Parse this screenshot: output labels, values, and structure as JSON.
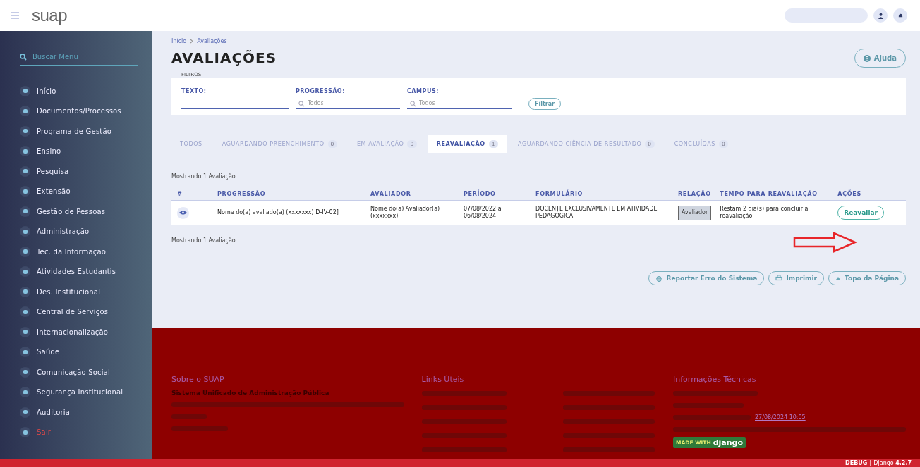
{
  "header": {
    "logo": "suap"
  },
  "sidebar": {
    "search": {
      "placeholder": "Buscar Menu"
    },
    "items": [
      {
        "label": "Início",
        "kind": "normal"
      },
      {
        "label": "Documentos/Processos",
        "kind": "normal"
      },
      {
        "label": "Programa de Gestão",
        "kind": "normal"
      },
      {
        "label": "Ensino",
        "kind": "normal"
      },
      {
        "label": "Pesquisa",
        "kind": "normal"
      },
      {
        "label": "Extensão",
        "kind": "normal"
      },
      {
        "label": "Gestão de Pessoas",
        "kind": "normal"
      },
      {
        "label": "Administração",
        "kind": "normal"
      },
      {
        "label": "Tec. da Informação",
        "kind": "normal"
      },
      {
        "label": "Atividades Estudantis",
        "kind": "normal"
      },
      {
        "label": "Des. Institucional",
        "kind": "normal"
      },
      {
        "label": "Central de Serviços",
        "kind": "normal"
      },
      {
        "label": "Internacionalização",
        "kind": "normal"
      },
      {
        "label": "Saúde",
        "kind": "normal"
      },
      {
        "label": "Comunicação Social",
        "kind": "normal"
      },
      {
        "label": "Segurança Institucional",
        "kind": "normal"
      },
      {
        "label": "Auditoria",
        "kind": "normal"
      },
      {
        "label": "Sair",
        "kind": "logout"
      }
    ]
  },
  "breadcrumb": [
    "Início",
    "Avaliações"
  ],
  "title": "AVALIAÇÕES",
  "help_button": "Ajuda",
  "filters": {
    "legend": "FILTROS",
    "fields": [
      {
        "label": "TEXTO:"
      },
      {
        "label": "PROGRESSÃO:",
        "placeholder": "Todos"
      },
      {
        "label": "CAMPUS:",
        "placeholder": "Todos"
      }
    ],
    "button": "Filtrar"
  },
  "tabs": [
    {
      "label": "TODOS",
      "selected": false
    },
    {
      "label": "AGUARDANDO PREENCHIMENTO",
      "count": "0",
      "selected": false
    },
    {
      "label": "EM AVALIAÇÃO",
      "count": "0",
      "selected": false
    },
    {
      "label": "REAVALIAÇÃO",
      "count": "1",
      "selected": true
    },
    {
      "label": "AGUARDANDO CIÊNCIA DE RESULTADO",
      "count": "0",
      "selected": false
    },
    {
      "label": "CONCLUÍDAS",
      "count": "0",
      "selected": false
    }
  ],
  "summary_top": "Mostrando 1 Avaliação",
  "table": {
    "columns": [
      "#",
      "PROGRESSÃO",
      "AVALIADOR",
      "PERÍODO",
      "FORMULÁRIO",
      "RELAÇÃO",
      "TEMPO PARA REAVALIAÇÃO",
      "AÇÕES"
    ],
    "rows": [
      {
        "progressao": "Nome do(a) avaliado(a) (xxxxxxx) D-IV-02]",
        "avaliador": "Nome do(a) Avaliador(a) (xxxxxxx)",
        "periodo": "07/08/2022 a 06/08/2024",
        "formulario": "DOCENTE EXCLUSIVAMENTE EM ATIVIDADE PEDAGÓGICA",
        "relacao": "Avaliador",
        "tempo": "Restam 2 dia(s) para concluir a reavaliação.",
        "acao": "Reavaliar"
      }
    ]
  },
  "summary_bottom": "Mostrando 1 Avaliação",
  "page_buttons": [
    {
      "label": "Reportar Erro do Sistema",
      "kind": "bug"
    },
    {
      "label": "Imprimir",
      "kind": "print"
    },
    {
      "label": "Topo da Página",
      "kind": "top"
    }
  ],
  "footer": {
    "about_title": "Sobre o SUAP",
    "about_name": "Sistema Unificado de Administração Pública",
    "links_title": "Links Úteis",
    "tech_title": "Informações Técnicas",
    "tech_date": "27/08/2024 10:05",
    "badge_prefix": "MADE WITH",
    "badge_name": "django"
  },
  "bottom_bar": {
    "mode": "DEBUG",
    "version_label": "Django",
    "version": "4.2.7"
  }
}
